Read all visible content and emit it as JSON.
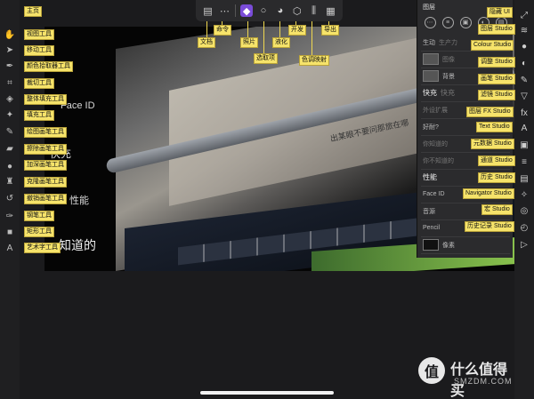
{
  "top_toolbar": {
    "icons": [
      "document-icon",
      "more-icon",
      "persona-photo-icon",
      "selection-icon",
      "liquify-icon",
      "develop-icon",
      "tone-map-icon",
      "export-icon"
    ]
  },
  "left_tool_labels": [
    "主页",
    "视图工具",
    "移动工具",
    "颜色拾取器工具",
    "裁切工具",
    "整体填充工具",
    "填充工具",
    "绘图画笔工具",
    "擦除画笔工具",
    "加深画笔工具",
    "克隆画笔工具",
    "撤销画笔工具",
    "钢笔工具",
    "矩形工具",
    "艺术字工具"
  ],
  "top_labels": {
    "doc": "文档",
    "cmd": "命令",
    "photo": "照片",
    "sel": "选取项",
    "liq": "液化",
    "dev": "开发",
    "tone": "色调映射",
    "exp": "导出"
  },
  "right_labels": [
    "隐藏 UI",
    "图层 Studio",
    "Colour Studio",
    "调整 Studio",
    "画笔 Studio",
    "滤镜 Studio",
    "图层 FX Studio",
    "Text Studio",
    "元数据 Studio",
    "通道 Studio",
    "历史 Studio",
    "Navigator Studio",
    "宏 Studio",
    "历史记录 Studio"
  ],
  "panel": {
    "title": "图层",
    "layers": [
      {
        "name": "生动",
        "sub": "生产力"
      },
      {
        "name": "",
        "sub": "图像"
      },
      {
        "name": "背景",
        "sub": ""
      },
      {
        "name": "快充",
        "sub": "快充"
      },
      {
        "name": "外设扩展",
        "sub": "外设扩展"
      },
      {
        "name": "好耐?",
        "sub": "好耐?"
      },
      {
        "name": "你知道的",
        "sub": "你知道的"
      },
      {
        "name": "你不知道的",
        "sub": "你不知道的"
      },
      {
        "name": "性能",
        "sub": "性能"
      },
      {
        "name": "Face ID",
        "sub": "Face ID"
      },
      {
        "name": "音源",
        "sub": "音源"
      },
      {
        "name": "Pencil",
        "sub": "Pencil"
      },
      {
        "name": "像素",
        "sub": ""
      }
    ]
  },
  "canvas_text": {
    "faceid": "Face ID",
    "kuaichong": "快充",
    "xingneng": "性能",
    "zhidao": "知道的",
    "caption": "出某眼不要问那旅在哪"
  },
  "watermark": {
    "logo": "值",
    "name": "什么值得买",
    "site": "SMZDM.COM"
  }
}
